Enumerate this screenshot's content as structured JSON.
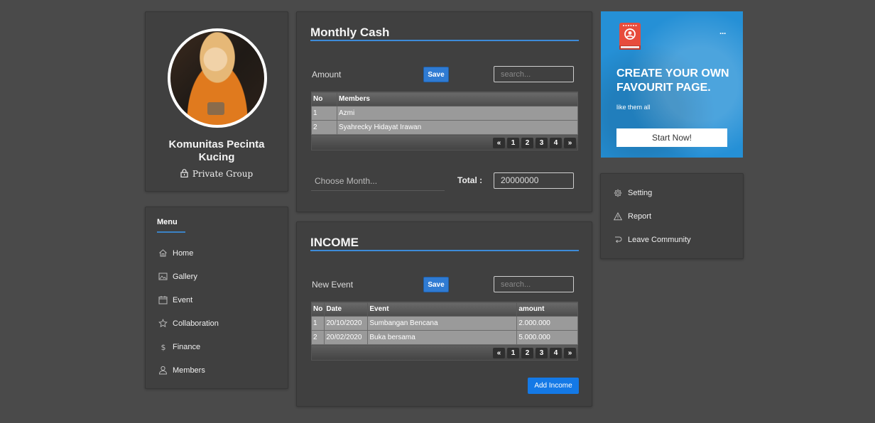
{
  "profile": {
    "name": "Komunitas Pecinta Kucing",
    "privacy": "Private Group"
  },
  "menu": {
    "title": "Menu",
    "items": [
      {
        "label": "Home",
        "icon": "home-icon"
      },
      {
        "label": "Gallery",
        "icon": "gallery-icon"
      },
      {
        "label": "Event",
        "icon": "calendar-icon"
      },
      {
        "label": "Collaboration",
        "icon": "star-icon"
      },
      {
        "label": "Finance",
        "icon": "dollar-icon"
      },
      {
        "label": "Members",
        "icon": "user-icon"
      }
    ]
  },
  "cash": {
    "title": "Monthly Cash",
    "amount_label": "Amount",
    "save_label": "Save",
    "search_placeholder": "search...",
    "columns": [
      "No",
      "Members"
    ],
    "rows": [
      {
        "no": "1",
        "member": "Azmi"
      },
      {
        "no": "2",
        "member": "Syahrecky Hidayat Irawan"
      }
    ],
    "pager": [
      "«",
      "1",
      "2",
      "3",
      "4",
      "»"
    ],
    "choose_month": "Choose Month...",
    "total_label": "Total :",
    "total_value": "20000000"
  },
  "income": {
    "title": "INCOME",
    "event_label": "New Event",
    "save_label": "Save",
    "search_placeholder": "search...",
    "columns": [
      "No",
      "Date",
      "Event",
      "amount"
    ],
    "rows": [
      {
        "no": "1",
        "date": "20/10/2020",
        "event": "Sumbangan Bencana",
        "amount": "2.000.000"
      },
      {
        "no": "2",
        "date": "20/02/2020",
        "event": "Buka bersama",
        "amount": "5.000.000"
      }
    ],
    "pager": [
      "«",
      "1",
      "2",
      "3",
      "4",
      "»"
    ],
    "add_label": "Add Income"
  },
  "promo": {
    "more": "···",
    "title": "CREATE YOUR OWN FAVOURIT PAGE.",
    "subtitle": "like them all",
    "button": "Start Now!",
    "icon": "passport-icon",
    "color": "#2590d6"
  },
  "side_menu": [
    {
      "label": "Setting",
      "icon": "gear-icon"
    },
    {
      "label": "Report",
      "icon": "warning-icon"
    },
    {
      "label": "Leave Community",
      "icon": "leave-icon"
    }
  ]
}
